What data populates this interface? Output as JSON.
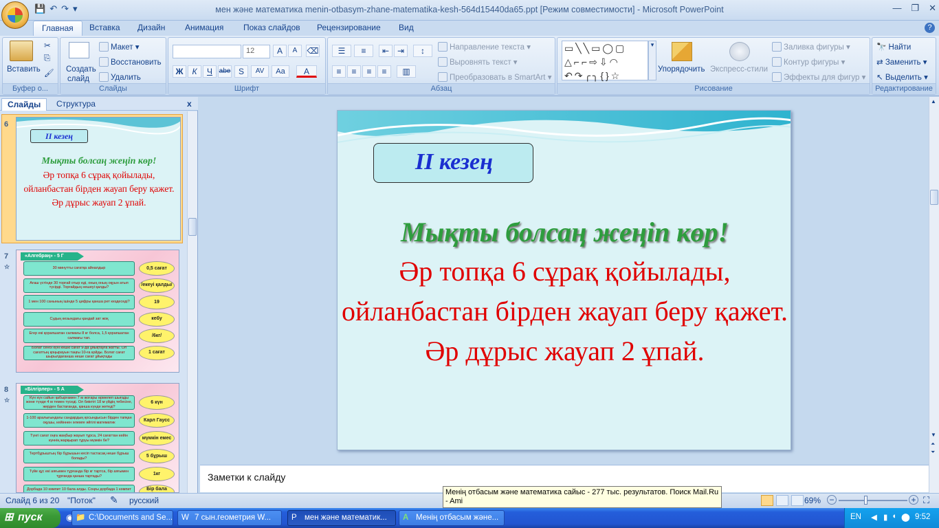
{
  "window": {
    "title": "мен және математика menin-otbasym-zhane-matematika-kesh-564d15440da65.ppt [Режим совместимости] - Microsoft PowerPoint"
  },
  "ribbon_tabs": [
    "Главная",
    "Вставка",
    "Дизайн",
    "Анимация",
    "Показ слайдов",
    "Рецензирование",
    "Вид"
  ],
  "clipboard": {
    "paste": "Вставить",
    "label": "Буфер о..."
  },
  "slides_group": {
    "create": "Создать",
    "create2": "слайд",
    "layout": "Макет",
    "reset": "Восстановить",
    "delete": "Удалить",
    "label": "Слайды"
  },
  "font_group": {
    "font_size": "12",
    "label": "Шрифт",
    "bold": "Ж",
    "italic": "К",
    "underline": "Ч",
    "strike": "abe",
    "shadow": "S",
    "spacing": "AV",
    "case": "Аа",
    "color": "A",
    "grow": "A",
    "shrink": "A"
  },
  "paragraph_group": {
    "text_direction": "Направление текста",
    "align_text": "Выровнять текст",
    "smartart": "Преобразовать в SmartArt",
    "label": "Абзац"
  },
  "drawing_group": {
    "arrange": "Упорядочить",
    "quick_styles": "Экспресс-стили",
    "fill": "Заливка фигуры",
    "outline": "Контур фигуры",
    "effects": "Эффекты для фигур",
    "label": "Рисование"
  },
  "editing_group": {
    "find": "Найти",
    "replace": "Заменить",
    "select": "Выделить",
    "label": "Редактирование"
  },
  "panel": {
    "tab_slides": "Слайды",
    "tab_outline": "Структура",
    "close": "x"
  },
  "thumbs": [
    {
      "num": "6",
      "badge": "II кезең",
      "slogan": "Мықты болсаң жеңіп көр!",
      "lines": [
        "Әр топқа 6 сұрақ қойылады,",
        "ойланбастан бірден жауап беру қажет.",
        "Әр дұрыс жауап 2 ұпай."
      ]
    },
    {
      "num": "7",
      "header": "«Алгебраң» - 5 Г",
      "rows": [
        {
          "q": "30 минутты сағатқа айналдыр",
          "a": "0,5 сағат"
        },
        {
          "q": "Ағаш үстінде 30 торғай отыр еді, оның оның оқуын атып түсірді. Торғайдың нешеуі қалды?",
          "a": "/екеуі қалды/"
        },
        {
          "q": "1 мен 100 санының ішінде 5 цифры қанша рет кездеседі?",
          "a": "19"
        },
        {
          "q": "Судың кезындағы қандай зат жоқ",
          "a": "кебу"
        },
        {
          "q": "Егер екі қорапшатан салмағы 8 кг болса, 1,5 қорапшатан салмағы тап.",
          "a": "/6кг/"
        },
        {
          "q": "Болат сенбі күні кешкі сағат 9-да ұйықтауға жатты. Ол сағаттың қоңырауын таңғы 10-ға қойды. Болат сағат шырылдағанша неше сағат ұйықтады",
          "a": "1 сағат"
        }
      ]
    },
    {
      "num": "8",
      "header": "«Білгірлер» - 5 А",
      "rows": [
        {
          "q": "Күн күн сайын қабырғамен 7 м жоғары өрмелеп шығады және түнде 4 м темен түседі. Ол биіктігі 18 м үйдің тебесіне, жерден бастағанда, қанша күнде жетеді?",
          "a": "6 күн"
        },
        {
          "q": "1-100 аралығындағы сандардың қосындысын бірден тапқан оқушы, кейіннен әлемге әйгілі математик",
          "a": "Карл Гаусс"
        },
        {
          "q": "Түнгі сағат оңға жаңбыр жауып тұрса, 24 сағаттан кейін күннің жарқырап тұруы мүмкін бе?",
          "a": "мүмкін емес"
        },
        {
          "q": "Тертбұрыштың бір бұрышын кесіп тастасақ неше бұрыш болады?",
          "a": "5 бұрыш"
        },
        {
          "q": "Түйе құс екі аяғымен тұрғанда бір кг тартса, бір аяғымен тұрғанда қанша тартады?",
          "a": "1кг"
        },
        {
          "q": "Дорбада 10 кәмпит 10 бала алды. Соңғы дорбада 1 кәмпит қалды. Қалай болады?",
          "a": "Бір бала дорбасымен"
        }
      ]
    }
  ],
  "slide": {
    "badge": "II кезең",
    "slogan": "Мықты болсаң жеңіп көр!",
    "lines": [
      "Әр топқа 6 сұрақ қойылады,",
      "ойланбастан бірден жауап беру қажет.",
      "Әр дұрыс жауап 2 ұпай."
    ]
  },
  "notes": {
    "placeholder": "Заметки к слайду"
  },
  "status": {
    "slide_info": "Слайд 6 из 20",
    "theme": "\"Поток\"",
    "language": "русский",
    "zoom": "69%"
  },
  "tooltip": {
    "text": "Менің отбасым және математика сайыс - 277 тыс. результатов. Поиск Mail.Ru - Ami"
  },
  "taskbar": {
    "start": "пуск",
    "items": [
      "C:\\Documents and Se...",
      "7 сын.геометрия  W...",
      "мен және математик...",
      "Менің отбасым және..."
    ],
    "lang": "EN",
    "clock": "9:52"
  },
  "colors": {
    "ribbon": "#d2e1f4",
    "slide_bg": "#dcf3f6",
    "slogan": "#2e9d3e",
    "body_text": "#e00000",
    "badge_text": "#1a2fd0"
  }
}
